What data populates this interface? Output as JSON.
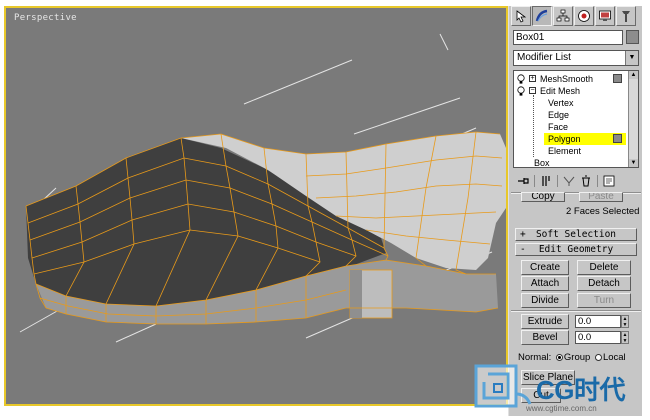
{
  "viewport": {
    "label": "Perspective",
    "border_color": "#e8c82a",
    "background": "#7a7a7a",
    "wireframe_color": "#e89a1a"
  },
  "panel": {
    "tabs": [
      "create-icon",
      "modify-icon",
      "hierarchy-icon",
      "motion-icon",
      "display-icon",
      "utilities-icon"
    ],
    "object_name": "Box01",
    "modifier_list_label": "Modifier List",
    "stack": [
      {
        "label": "MeshSmooth",
        "expander": "+"
      },
      {
        "label": "Edit Mesh",
        "expander": "−"
      },
      {
        "label": "Vertex"
      },
      {
        "label": "Edge"
      },
      {
        "label": "Face"
      },
      {
        "label": "Polygon",
        "selected": true,
        "highlight": "#ffff00"
      },
      {
        "label": "Element"
      },
      {
        "label": "Box"
      }
    ],
    "stack_tools": [
      "pin-stack-icon",
      "show-end-result-icon",
      "make-unique-icon",
      "remove-modifier-icon",
      "configure-modifier-sets-icon"
    ],
    "copy_label": "Copy",
    "paste_label": "Paste",
    "selection_status": "2 Faces Selected",
    "rollouts": {
      "soft_selection": {
        "sign": "+",
        "label": "Soft Selection"
      },
      "edit_geometry": {
        "sign": "-",
        "label": "Edit Geometry"
      }
    },
    "buttons": {
      "create": "Create",
      "delete": "Delete",
      "attach": "Attach",
      "detach": "Detach",
      "divide": "Divide",
      "turn": "Turn",
      "extrude": "Extrude",
      "bevel": "Bevel"
    },
    "extrude_value": "0.0",
    "bevel_value": "0.0",
    "normal_label": "Normal:",
    "normal_options": [
      "Group",
      "Local"
    ],
    "normal_selected": "Group",
    "slice_plane_label": "Slice Plane",
    "cut_label": "Cut"
  },
  "watermark": {
    "logo_text": "CG时代",
    "url": "www.cgtime.com.cn"
  }
}
